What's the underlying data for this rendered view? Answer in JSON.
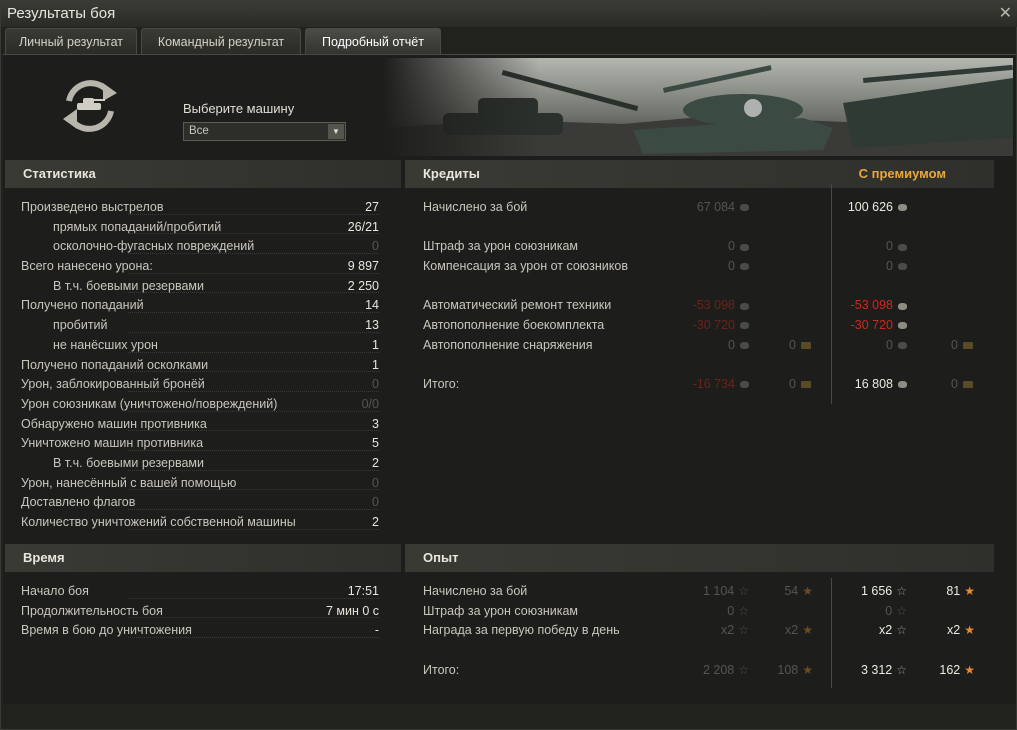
{
  "window": {
    "title": "Результаты боя"
  },
  "tabs": [
    {
      "label": "Личный результат"
    },
    {
      "label": "Командный результат"
    },
    {
      "label": "Подробный отчёт"
    }
  ],
  "vehicle": {
    "label": "Выберите машину",
    "selected": "Все"
  },
  "stats": {
    "header": "Статистика",
    "rows": [
      {
        "label": "Произведено выстрелов",
        "value": "27"
      },
      {
        "label": "прямых попаданий/пробитий",
        "value": "26/21"
      },
      {
        "label": "осколочно-фугасных повреждений",
        "value": "0"
      },
      {
        "label": "Всего нанесено урона:",
        "value": "9 897"
      },
      {
        "label": "В т.ч. боевыми резервами",
        "value": "2 250"
      },
      {
        "label": "Получено попаданий",
        "value": "14"
      },
      {
        "label": "пробитий",
        "value": "13"
      },
      {
        "label": "не нанёсших урон",
        "value": "1"
      },
      {
        "label": "Получено попаданий осколками",
        "value": "1"
      },
      {
        "label": "Урон, заблокированный бронёй",
        "value": "0"
      },
      {
        "label": "Урон союзникам (уничтожено/повреждений)",
        "value": "0/0"
      },
      {
        "label": "Обнаружено машин противника",
        "value": "3"
      },
      {
        "label": "Уничтожено машин противника",
        "value": "5"
      },
      {
        "label": "В т.ч. боевыми резервами",
        "value": "2"
      },
      {
        "label": "Урон, нанесённый с вашей помощью",
        "value": "0"
      },
      {
        "label": "Доставлено флагов",
        "value": "0"
      },
      {
        "label": "Количество уничтожений собственной машины",
        "value": "2"
      }
    ]
  },
  "time": {
    "header": "Время",
    "rows": [
      {
        "label": "Начало боя",
        "value": "17:51"
      },
      {
        "label": "Продолжительность боя",
        "value": "7 мин 0 с"
      },
      {
        "label": "Время в бою до уничтожения",
        "value": "-"
      }
    ]
  },
  "credits": {
    "header": "Кредиты",
    "premium_label": "С премиумом",
    "rows": [
      {
        "label": "Начислено за бой",
        "base": "67 084",
        "prem": "100 626"
      },
      {
        "label": "",
        "base": "",
        "prem": ""
      },
      {
        "label": "Штраф за урон союзникам",
        "base": "0",
        "prem": "0"
      },
      {
        "label": "Компенсация за урон от союзников",
        "base": "0",
        "prem": "0"
      },
      {
        "label": "",
        "base": "",
        "prem": ""
      },
      {
        "label": "Автоматический ремонт техники",
        "base": "-53 098",
        "prem": "-53 098"
      },
      {
        "label": "Автопополнение боекомплекта",
        "base": "-30 720",
        "prem": "-30 720"
      },
      {
        "label": "Автопополнение снаряжения",
        "base": "0",
        "base_gold": "0",
        "prem": "0",
        "prem_gold": "0"
      },
      {
        "label": "",
        "base": "",
        "prem": ""
      },
      {
        "label": "Итого:",
        "base": "-16 734",
        "base_gold": "0",
        "prem": "16 808",
        "prem_gold": "0"
      }
    ]
  },
  "xp": {
    "header": "Опыт",
    "rows": [
      {
        "label": "Начислено за бой",
        "base": "1 104",
        "base_free": "54",
        "prem": "1 656",
        "prem_free": "81"
      },
      {
        "label": "Штраф за урон союзникам",
        "base": "0",
        "base_free": "",
        "prem": "0",
        "prem_free": ""
      },
      {
        "label": "Награда за первую победу в день",
        "base": "x2",
        "base_free": "x2",
        "prem": "x2",
        "prem_free": "x2"
      },
      {
        "label": "",
        "base": "",
        "base_free": "",
        "prem": "",
        "prem_free": ""
      },
      {
        "label": "Итого:",
        "base": "2 208",
        "base_free": "108",
        "prem": "3 312",
        "prem_free": "162"
      }
    ]
  },
  "colors": {
    "accent": "#e8a840",
    "negative": "#cc2a1a"
  },
  "icons": {
    "close": "close-icon",
    "swap": "vehicle-swap-icon",
    "credit": "credit-icon",
    "gold": "gold-icon",
    "xp": "xp-star-icon",
    "free_xp": "free-xp-star-icon"
  }
}
